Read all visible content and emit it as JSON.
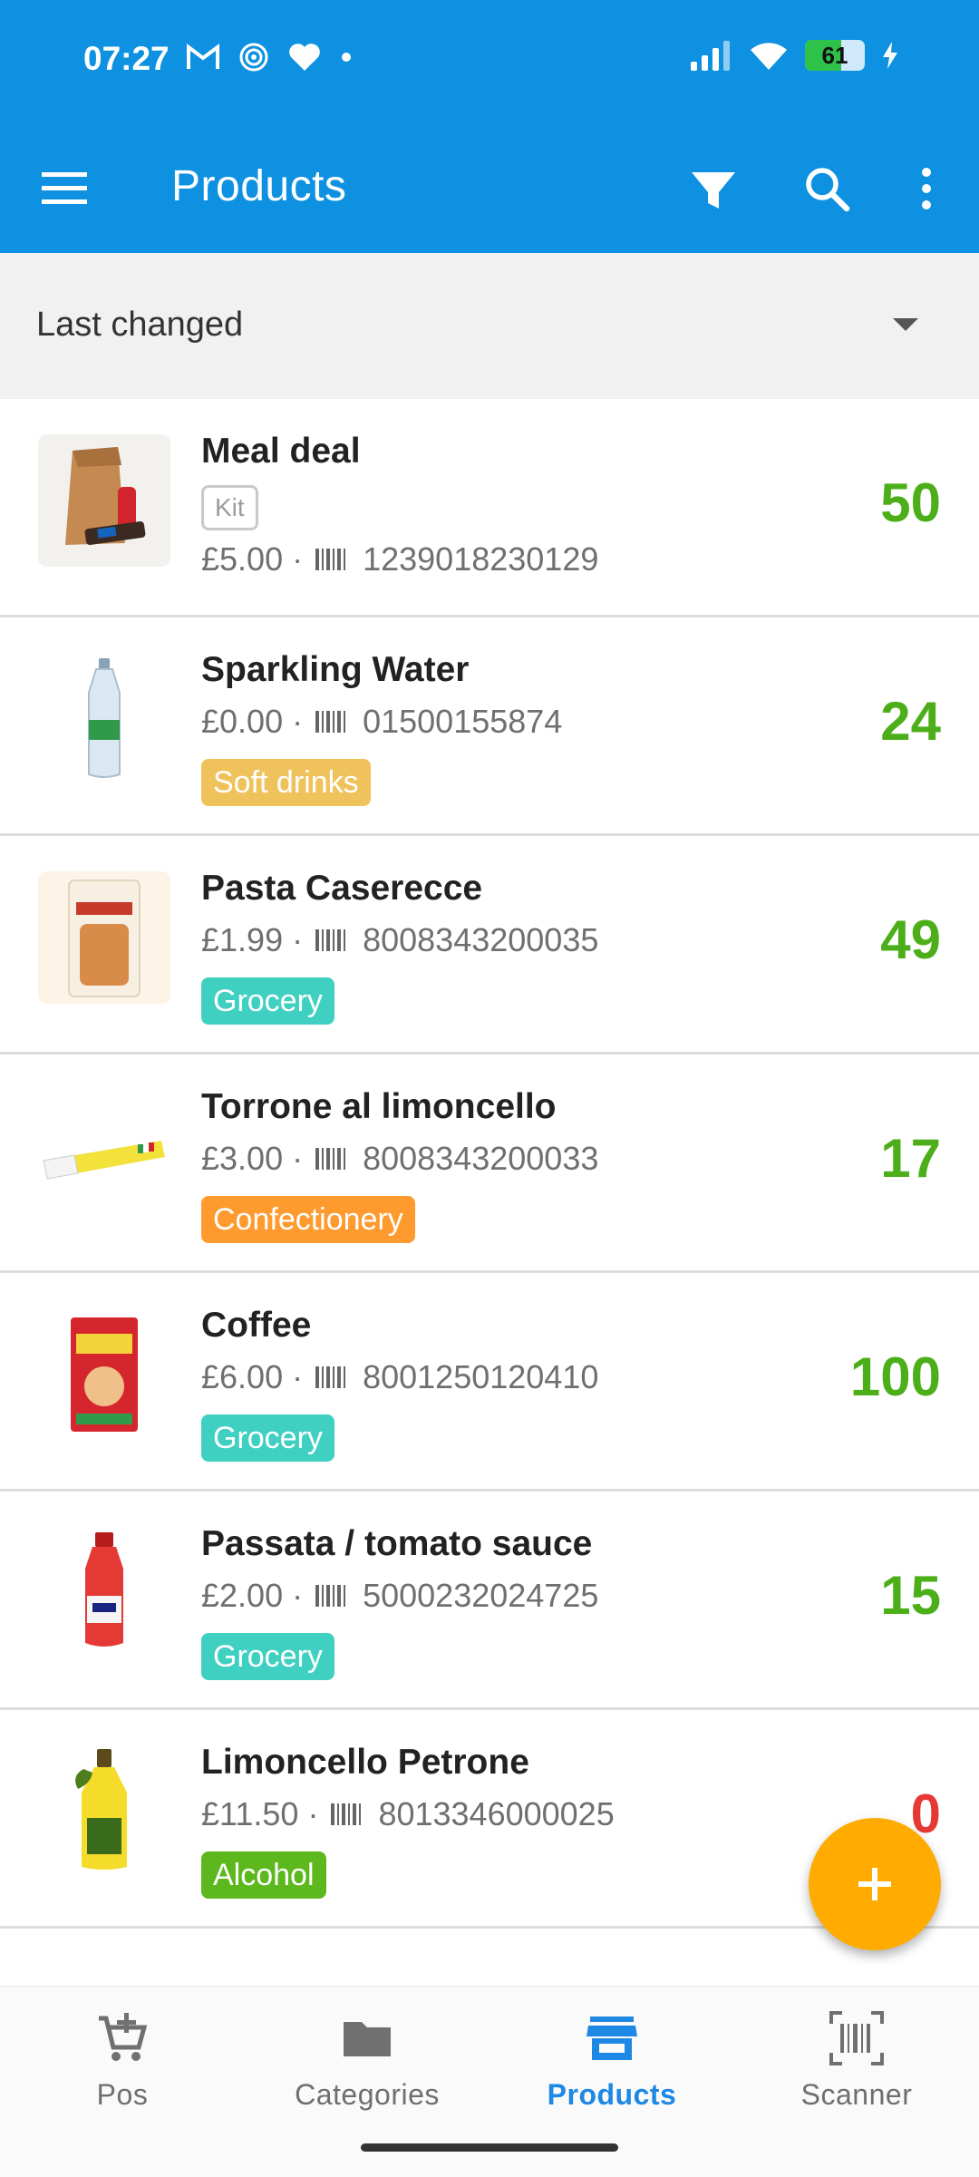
{
  "status_bar": {
    "time": "07:27",
    "battery": "61"
  },
  "app_bar": {
    "title": "Products"
  },
  "sort": {
    "label": "Last changed"
  },
  "products": [
    {
      "name": "Meal deal",
      "kit_label": "Kit",
      "price": "£5.00",
      "sep": "·",
      "barcode": "1239018230129",
      "quantity": "50"
    },
    {
      "name": "Sparkling Water",
      "price": "£0.00",
      "sep": "·",
      "barcode": "01500155874",
      "category": "Soft drinks",
      "category_color": "#f0c25c",
      "quantity": "24"
    },
    {
      "name": "Pasta Caserecce",
      "price": "£1.99",
      "sep": "·",
      "barcode": "8008343200035",
      "category": "Grocery",
      "category_color": "#3fd0c2",
      "quantity": "49"
    },
    {
      "name": "Torrone al limoncello",
      "price": "£3.00",
      "sep": "·",
      "barcode": "8008343200033",
      "category": "Confectionery",
      "category_color": "#ff9a2e",
      "quantity": "17"
    },
    {
      "name": "Coffee",
      "price": "£6.00",
      "sep": "·",
      "barcode": "8001250120410",
      "category": "Grocery",
      "category_color": "#3fd0c2",
      "quantity": "100"
    },
    {
      "name": "Passata / tomato sauce",
      "price": "£2.00",
      "sep": "·",
      "barcode": "5000232024725",
      "category": "Grocery",
      "category_color": "#3fd0c2",
      "quantity": "15"
    },
    {
      "name": "Limoncello Petrone",
      "price": "£11.50",
      "sep": "·",
      "barcode": "8013346000025",
      "category": "Alcohol",
      "category_color": "#5cb81d",
      "quantity": "0"
    }
  ],
  "fab": {
    "icon": "plus-icon"
  },
  "bottom_nav": [
    {
      "label": "Pos",
      "icon": "cart-add-icon"
    },
    {
      "label": "Categories",
      "icon": "folder-icon"
    },
    {
      "label": "Products",
      "icon": "store-icon",
      "active": true
    },
    {
      "label": "Scanner",
      "icon": "barcode-scan-icon"
    }
  ],
  "colors": {
    "primary": "#0d91e0",
    "accent": "#ffab00",
    "qty_positive": "#4caf1a",
    "qty_zero": "#e53935",
    "nav_active": "#1e88e5"
  }
}
